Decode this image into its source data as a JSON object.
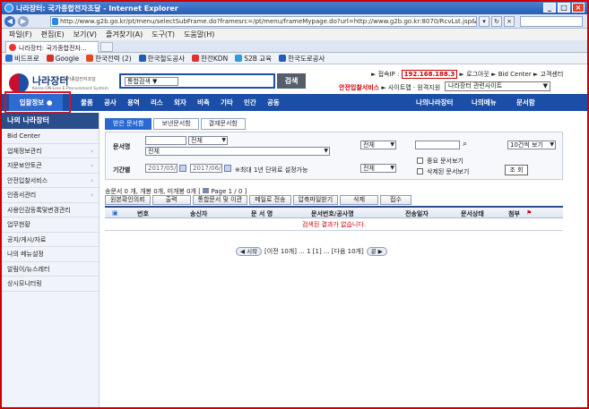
{
  "window": {
    "title": "나라장터: 국가종합전자조달 - Internet Explorer",
    "buttons": [
      "_",
      "□",
      "×"
    ]
  },
  "addressbar": {
    "url": "http://www.g2b.go.kr/pt/menu/selectSubFrame.do?framesrc=/pt/menu/frameMypage.do?url=http://www.g2b.go.kr:8070/RcvLst.jsp&menuId=&a..."
  },
  "menubar": [
    "파일(F)",
    "편집(E)",
    "보기(V)",
    "즐겨찾기(A)",
    "도구(T)",
    "도움말(H)"
  ],
  "tab": {
    "label": "나라장터: 국가종합전자..."
  },
  "favorites": [
    {
      "label": "비드프로",
      "color": "#2f6fd1"
    },
    {
      "label": "Google",
      "color": "#d93025"
    },
    {
      "label": "한국전력 (2)",
      "color": "#e34b1f"
    },
    {
      "label": "한국철도공사",
      "color": "#1d5fb8"
    },
    {
      "label": "한전KDN",
      "color": "#e33131"
    },
    {
      "label": "S2B 교육",
      "color": "#2f9be3"
    },
    {
      "label": "한국도로공사",
      "color": "#1d5fb8"
    }
  ],
  "header": {
    "logo_title": "나라장터",
    "logo_sub": "국가종합전자조달",
    "logo_en": "Korea ON-Line E-Procurement System",
    "search_select": "통합검색",
    "search_button": "검색",
    "ip_label": "► 접속IP :",
    "ip_value": "192.168.188.3",
    "util_links": "► 로그아웃   ► Bid Center   ► 고객센터",
    "notice_red": "안전입찰서비스",
    "util_links2": "► 사이트맵 · 원격지원",
    "related_select": "나라장터 관련사이트"
  },
  "gnb": {
    "home": "입찰정보",
    "items": [
      "물품",
      "공사",
      "용역",
      "리스",
      "외자",
      "비축",
      "기타",
      "민간",
      "공동"
    ],
    "right": [
      "나의나라장터",
      "나의메뉴",
      "문서함"
    ]
  },
  "sidebar": {
    "title": "나의 나라장터",
    "items": [
      "Bid Center",
      "업체정보관리",
      "지문보안토큰",
      "안전입찰서비스",
      "인증서관리",
      "사용인감등록및변경관리",
      "업무현황",
      "공지/게시/자료",
      "나의 메뉴설정",
      "알림이/뉴스레터",
      "상시모니터링"
    ]
  },
  "main": {
    "tabs": [
      "받은 문서함",
      "보낸문서함",
      "결재문서함"
    ],
    "filter": {
      "doc_label": "문서명",
      "doc_select1": "전체",
      "doc_select2": "전체",
      "period_label": "기간별",
      "date_from": "2017/05/26",
      "date_to": "2017/06/28",
      "period_note": "※최대 1년 단위로 설정가능",
      "right_select1": "전체",
      "right_select2": "전체",
      "count_select": "10건씩 보기",
      "check1": "중요 문서보기",
      "check2": "삭제된 문서보기",
      "query_button": "조 회"
    },
    "summary": "송문서 0 개, 개봉 0개, 미개봉 0개 [",
    "page_info": "Page 1 / 0 ]",
    "actions": [
      "원본확인의뢰",
      "출력",
      "통합문서 및 이관",
      "메일로 전송",
      "압축파일받기",
      "삭제",
      "접수"
    ],
    "columns": [
      "번호",
      "송신자",
      "문 서 명",
      "문서번호/공사명",
      "전송일자",
      "문서상태",
      "첨부"
    ],
    "empty_message": "검색된 결과가 없습니다.",
    "pager": {
      "first": "시작",
      "prev": "[이전 10개] ... 1 [1] ... [다음 10개]",
      "last": "끝"
    }
  }
}
